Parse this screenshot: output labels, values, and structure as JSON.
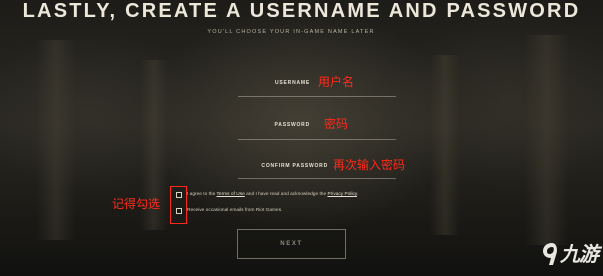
{
  "header": {
    "title": "LASTLY, CREATE A USERNAME AND PASSWORD",
    "subtitle": "YOU'LL CHOOSE YOUR IN-GAME NAME LATER"
  },
  "form": {
    "username": {
      "label": "USERNAME",
      "value": ""
    },
    "password": {
      "label": "PASSWORD",
      "value": ""
    },
    "confirm_password": {
      "label": "CONFIRM PASSWORD",
      "value": ""
    }
  },
  "checkboxes": {
    "terms": {
      "checked": false,
      "text_before": "I agree to the ",
      "terms_link": "Terms of Use",
      "text_middle": " and I have read and acknowledge the ",
      "privacy_link": "Privacy Policy",
      "text_after": "."
    },
    "emails": {
      "checked": false,
      "text": "Receive occasional emails from Riot Games."
    }
  },
  "next_button": {
    "label": "NEXT"
  },
  "annotations": {
    "username": "用户名",
    "password": "密码",
    "confirm_password": "再次输入密码",
    "checkboxes": "记得勾选"
  },
  "annotation_color": "#ff2a1a",
  "watermark": {
    "text": "九游",
    "icon": "nine-game-logo-icon"
  }
}
